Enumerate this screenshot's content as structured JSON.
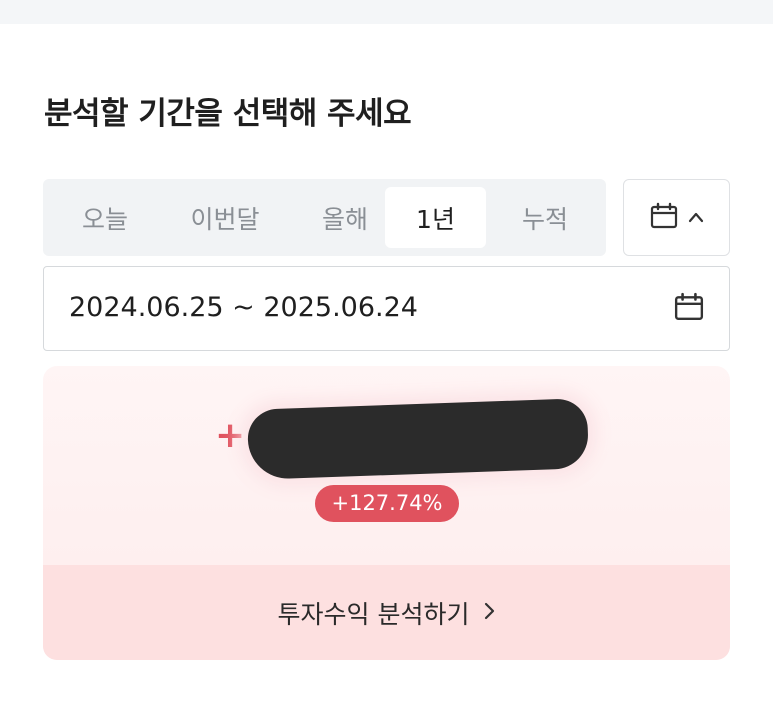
{
  "header": {
    "title": "분석할 기간을 선택해 주세요"
  },
  "period_tabs": [
    {
      "label": "오늘",
      "active": false
    },
    {
      "label": "이번달",
      "active": false
    },
    {
      "label": "올해",
      "active": false
    },
    {
      "label": "1년",
      "active": true
    },
    {
      "label": "누적",
      "active": false
    }
  ],
  "calendar_toggle": {
    "icon": "calendar-icon",
    "chevron": "chevron-up-icon"
  },
  "date_range": {
    "text": "2024.06.25 ~ 2025.06.24",
    "icon": "calendar-icon"
  },
  "result": {
    "sign": "+",
    "amount_redacted": true,
    "return_badge": "+127.74%"
  },
  "analyze_button": {
    "label": "투자수익 분석하기",
    "icon": "chevron-right-icon"
  },
  "colors": {
    "accent_red": "#e0525e",
    "card_bg": "#fdecec",
    "button_bg": "#fde0e0",
    "segment_bg": "#f1f3f5"
  }
}
